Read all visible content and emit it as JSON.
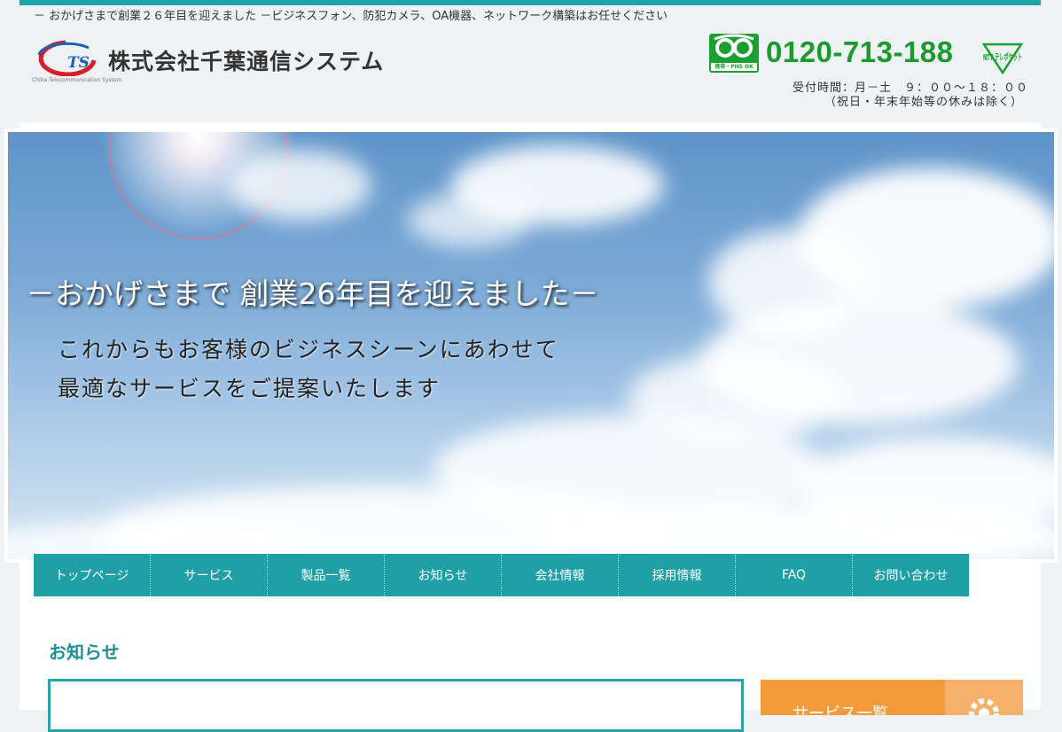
{
  "header": {
    "tagline": "－ おかげさまで創業２６年目を迎えました －ビジネスフォン、防犯カメラ、OA機器、ネットワーク構築はお任せください",
    "logo_name": "株式会社千葉通信システム",
    "logo_sub": "Chiba Telecommunication System",
    "logo_mark_text": "TS",
    "phone": {
      "freedial_ok": "携帯・PHS OK",
      "number": "0120-713-188",
      "ntt_label": "NTT テレポケット",
      "hours_line1": "受付時間：月－土　９：００～１８：００",
      "hours_line2": "（祝日・年末年始等の休みは除く）"
    }
  },
  "hero": {
    "heading": "－おかげさまで 創業26年目を迎えました－",
    "line1": "これからもお客様のビジネスシーンにあわせて",
    "line2": "最適なサービスをご提案いたします"
  },
  "nav": {
    "items": [
      {
        "label": "トップページ"
      },
      {
        "label": "サービス"
      },
      {
        "label": "製品一覧"
      },
      {
        "label": "お知らせ"
      },
      {
        "label": "会社情報"
      },
      {
        "label": "採用情報"
      },
      {
        "label": "FAQ"
      },
      {
        "label": "お問い合わせ"
      }
    ]
  },
  "main": {
    "news_heading": "お知らせ"
  },
  "sidebar": {
    "banner_label": "サービス一覧"
  },
  "colors": {
    "accent": "#20a0a6",
    "phone_green": "#1c9a2d",
    "banner_orange": "#f39a3a"
  },
  "icons": {
    "freedial": "freedial-icon",
    "ntt": "ntt-telepocket-icon",
    "gear": "gear-icon"
  }
}
